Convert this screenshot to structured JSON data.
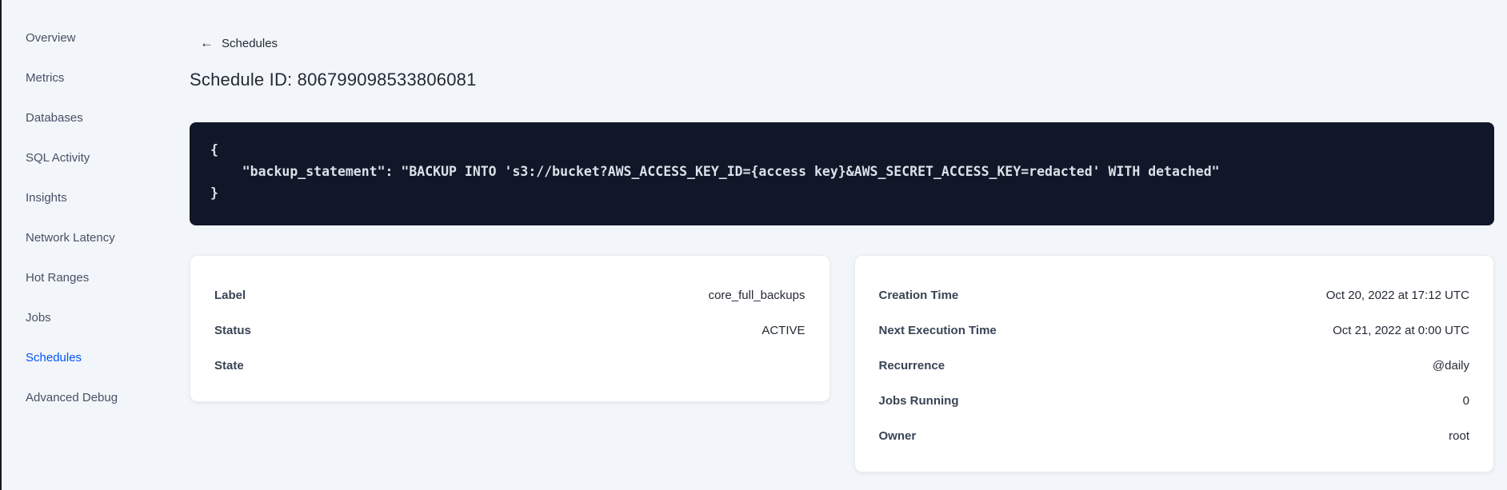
{
  "theme": {
    "page-bg": "#f2f5f9",
    "edge": "#141a26",
    "accent": "#0055ff",
    "nav-text": "#475066",
    "text-dark": "#242a35",
    "label-color": "#394455",
    "code-bg": "#0f1728",
    "code-fg": "#dbe1e9",
    "card-border": "#e7ecf2"
  },
  "sidebar": {
    "items": [
      {
        "label": "Overview",
        "active": false
      },
      {
        "label": "Metrics",
        "active": false
      },
      {
        "label": "Databases",
        "active": false
      },
      {
        "label": "SQL Activity",
        "active": false
      },
      {
        "label": "Insights",
        "active": false
      },
      {
        "label": "Network Latency",
        "active": false
      },
      {
        "label": "Hot Ranges",
        "active": false
      },
      {
        "label": "Jobs",
        "active": false
      },
      {
        "label": "Schedules",
        "active": true
      },
      {
        "label": "Advanced Debug",
        "active": false
      }
    ]
  },
  "header": {
    "back_arrow_glyph": "←",
    "back_label": "Schedules",
    "title": "Schedule ID: 806799098533806081"
  },
  "code_block": {
    "lines": [
      "{",
      "    \"backup_statement\": \"BACKUP INTO 's3://bucket?AWS_ACCESS_KEY_ID={access key}&AWS_SECRET_ACCESS_KEY=redacted' WITH detached\"",
      "}"
    ]
  },
  "details_card": {
    "rows": [
      {
        "label": "Label",
        "value": "core_full_backups"
      },
      {
        "label": "Status",
        "value": "ACTIVE"
      },
      {
        "label": "State",
        "value": ""
      }
    ]
  },
  "schedule_card": {
    "rows": [
      {
        "label": "Creation Time",
        "value": "Oct 20, 2022 at 17:12 UTC"
      },
      {
        "label": "Next Execution Time",
        "value": "Oct 21, 2022 at 0:00 UTC"
      },
      {
        "label": "Recurrence",
        "value": "@daily"
      },
      {
        "label": "Jobs Running",
        "value": "0"
      },
      {
        "label": "Owner",
        "value": "root"
      }
    ]
  }
}
